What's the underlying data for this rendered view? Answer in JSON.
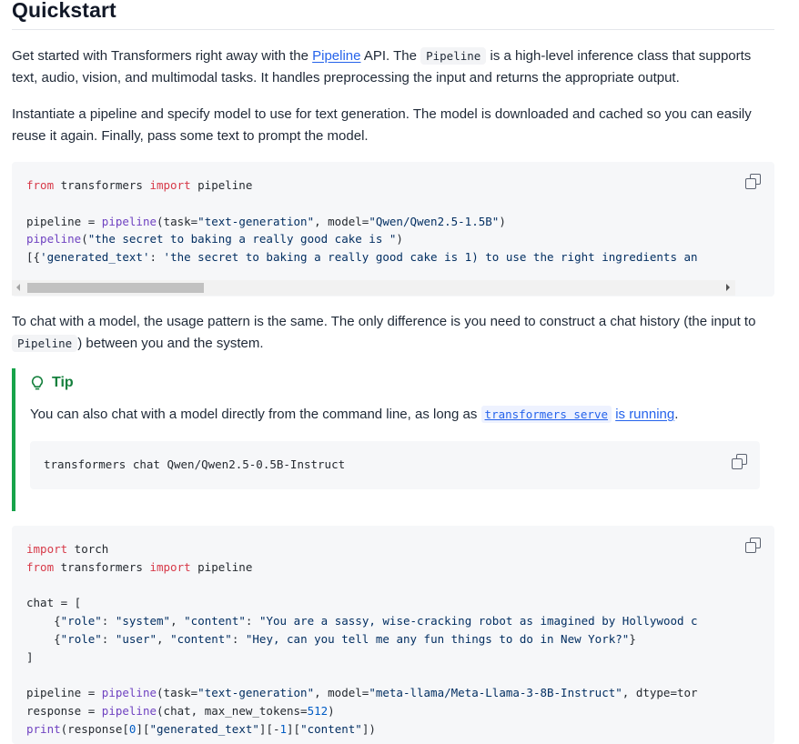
{
  "header": {
    "title": "Quickstart"
  },
  "intro": {
    "p1_a": "Get started with Transformers right away with the ",
    "p1_link": "Pipeline",
    "p1_b": " API. The ",
    "p1_code": "Pipeline",
    "p1_c": " is a high-level inference class that supports text, audio, vision, and multimodal tasks. It handles preprocessing the input and returns the appropriate output.",
    "p2": "Instantiate a pipeline and specify model to use for text generation. The model is downloaded and cached so you can easily reuse it again. Finally, pass some text to prompt the model."
  },
  "code1": {
    "lines": [
      "from transformers import pipeline",
      "",
      "pipeline = pipeline(task=\"text-generation\", model=\"Qwen/Qwen2.5-1.5B\")",
      "pipeline(\"the secret to baking a really good cake is \")",
      "[{'generated_text': 'the secret to baking a really good cake is 1) to use the right ingredients an"
    ]
  },
  "chat_para": {
    "a": "To chat with a model, the usage pattern is the same. The only difference is you need to construct a chat history (the input to ",
    "code": "Pipeline",
    "b": ") between you and the system."
  },
  "tip": {
    "title": "Tip",
    "text_a": "You can also chat with a model directly from the command line, as long as ",
    "code_link": "transformers serve",
    "link": "is running",
    "text_b": ".",
    "command": "transformers chat Qwen/Qwen2.5-0.5B-Instruct"
  },
  "code2": {
    "lines": [
      "import torch",
      "from transformers import pipeline",
      "",
      "chat = [",
      "    {\"role\": \"system\", \"content\": \"You are a sassy, wise-cracking robot as imagined by Hollywood c",
      "    {\"role\": \"user\", \"content\": \"Hey, can you tell me any fun things to do in New York?\"}",
      "]",
      "",
      "pipeline = pipeline(task=\"text-generation\", model=\"meta-llama/Meta-Llama-3-8B-Instruct\", dtype=tor",
      "response = pipeline(chat, max_new_tokens=512)",
      "print(response[0][\"generated_text\"][-1][\"content\"])"
    ]
  },
  "icons": {
    "copy": "copy-icon",
    "tip": "lightbulb-icon"
  },
  "colors": {
    "accent": "#16a34a",
    "link": "#2563eb",
    "keyword": "#d73a49",
    "function": "#6f42c1",
    "string": "#032f62"
  }
}
